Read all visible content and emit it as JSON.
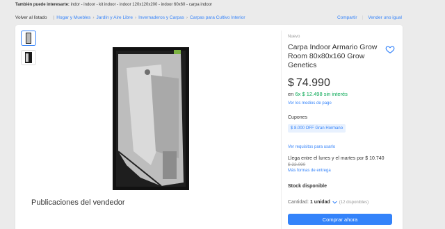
{
  "also_search": {
    "label": "También puede interesarte:",
    "terms": "indor - indoor - kit indoor - indoor 120x120x200 - indoor 60x60 - carpa indoor"
  },
  "breadcrumb": {
    "back": "Volver al listado",
    "items": [
      "Hogar y Muebles",
      "Jardín y Aire Libre",
      "Invernaderos y Carpas",
      "Carpas para Cultivo Interior"
    ]
  },
  "header_actions": {
    "share": "Compartir",
    "sell": "Vender uno igual"
  },
  "product": {
    "condition": "Nuevo",
    "title": "Carpa Indoor Armario Grow Room 80x80x160 Grow Genetics",
    "currency": "$",
    "price": "74.990",
    "installments_prefix": "en",
    "installments": "6x $ 12.498 sin interés",
    "payment_link": "Ver los medios de pago",
    "coupons_title": "Cupones",
    "coupon": "$ 8.000 OFF Gran Hormano",
    "requirements_link": "Ver requisitos para usarlo",
    "shipping": "Llega entre el lunes y el martes por $ 10.740",
    "shipping_old": "$ 22.090",
    "shipping_link": "Más formas de entrega",
    "stock": "Stock disponible",
    "quantity_label": "Cantidad:",
    "quantity_value": "1 unidad",
    "quantity_available": "(12 disponibles)",
    "buy_button": "Comprar ahora"
  },
  "seller_publications": "Publicaciones del vendedor",
  "colors": {
    "accent": "#3483fa",
    "green": "#00a650",
    "background": "#ebebeb"
  }
}
